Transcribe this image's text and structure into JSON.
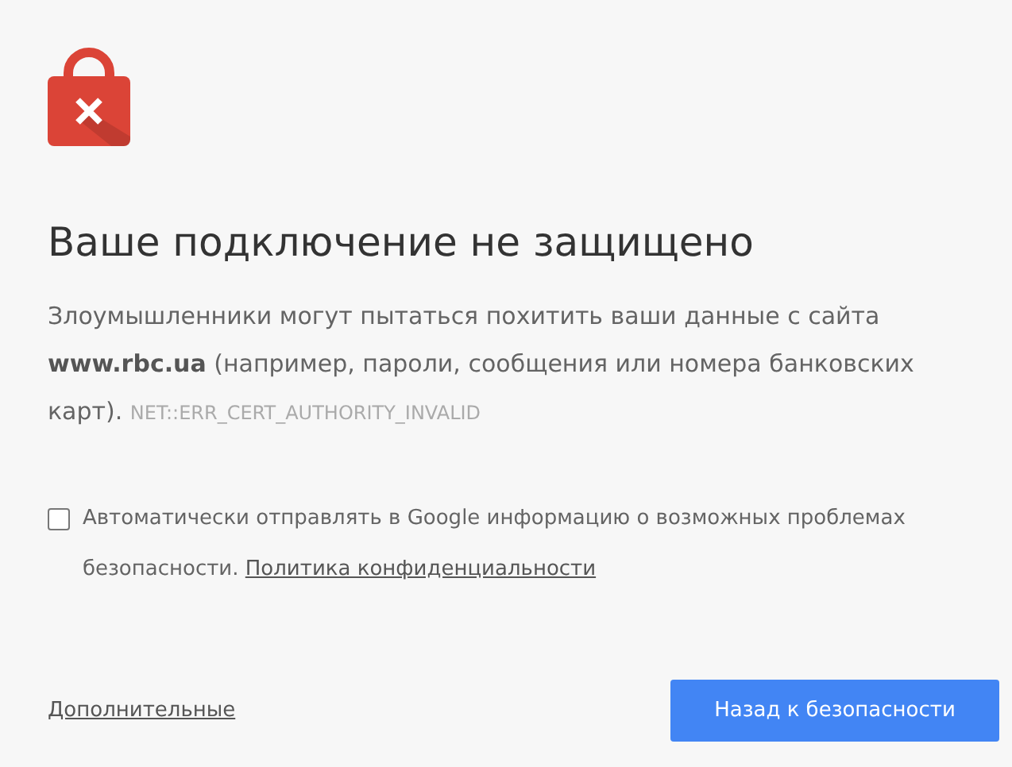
{
  "heading": "Ваше подключение не защищено",
  "message": "Злоумышленники могут пытаться похитить ваши данные с сайта **www.rbc.ua** (например, пароли, сообщения или номера банковских карт).",
  "error_code": "NET::ERR_CERT_AUTHORITY_INVALID",
  "report": {
    "checked": false,
    "label": "Автоматически отправлять в Google информацию о возможных проблемах безопасности.",
    "link": "Политика конфиденциальности"
  },
  "details_link": "Дополнительные",
  "back_button": "Назад к безопасности"
}
